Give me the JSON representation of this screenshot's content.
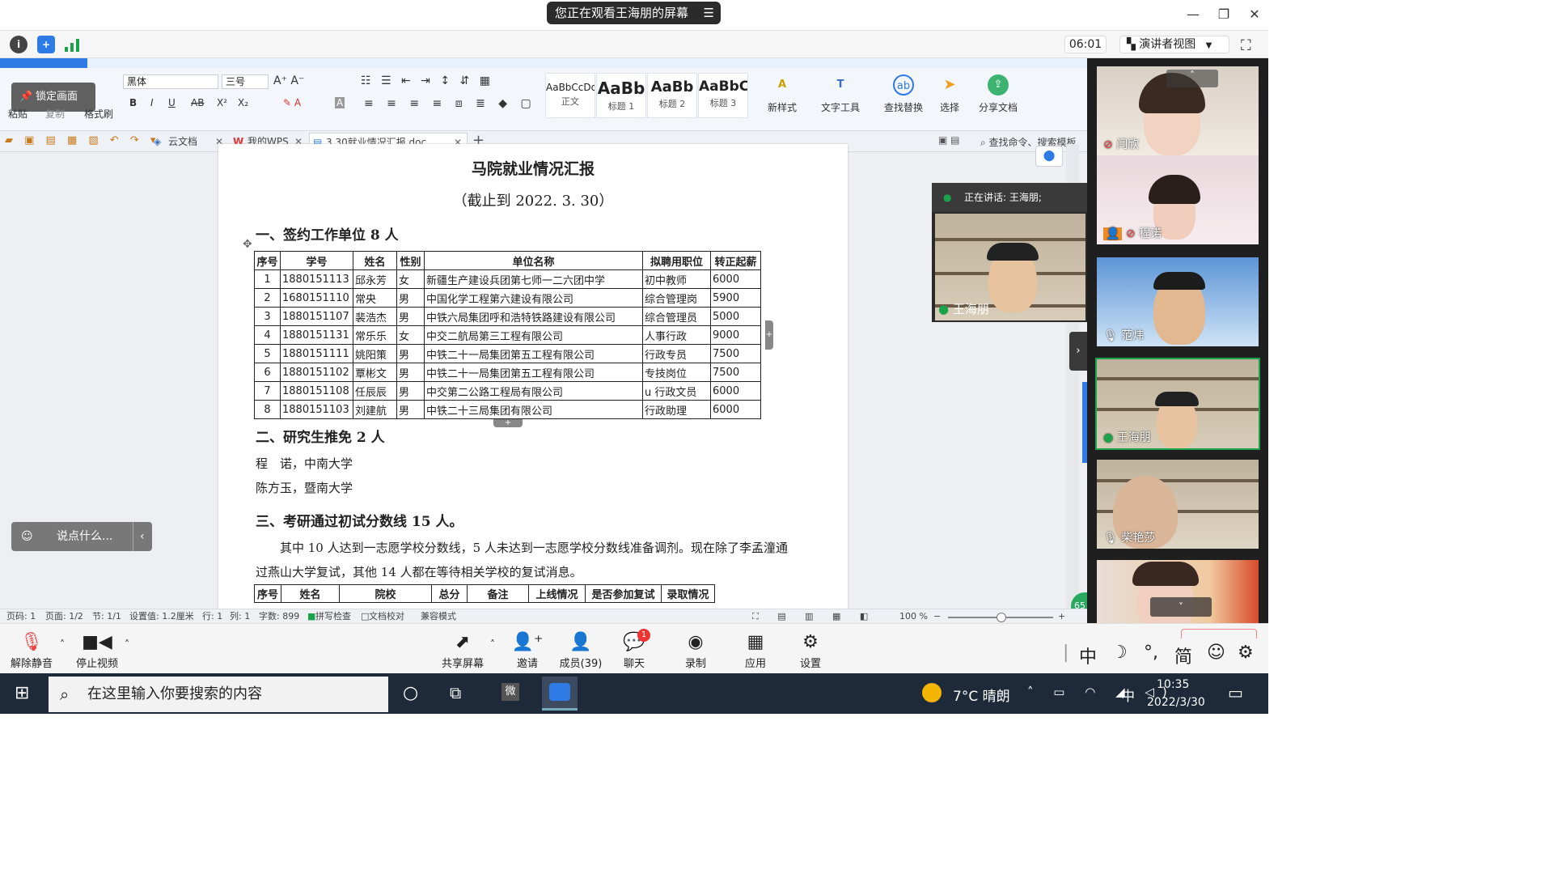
{
  "banner": {
    "text": "您正在观看王海朋的屏幕",
    "menu_icon": "list-icon"
  },
  "window_controls": {
    "minimize": "—",
    "restore": "❐",
    "close": "✕"
  },
  "meeting_top": {
    "timer": "06:01",
    "view_mode": "演讲者视图",
    "view_icon": "chevron-down-icon"
  },
  "wps": {
    "lock_screen": "锁定画面",
    "font_name": "黑体",
    "font_size": "三号",
    "format_row": [
      "B",
      "I",
      "U",
      "AB",
      "X²",
      "X₂"
    ],
    "clipboard": {
      "paste": "粘贴",
      "copy": "复制",
      "format_brush": "格式刷"
    },
    "styles": [
      {
        "sample": "AaBbCcDd",
        "name": "正文"
      },
      {
        "sample": "AaBb",
        "name": "标题 1"
      },
      {
        "sample": "AaBb",
        "name": "标题 2"
      },
      {
        "sample": "AaBbC",
        "name": "标题 3"
      }
    ],
    "tools": [
      "新样式",
      "文字工具",
      "查找替换",
      "选择",
      "分享文档"
    ],
    "tabs": [
      "云文档",
      "我的WPS",
      "3.30就业情况汇报.doc"
    ],
    "search_command": "查找命令、搜索模板"
  },
  "doc": {
    "title": "马院就业情况汇报",
    "subtitle": "（截止到 2022. 3. 30）",
    "section1": "一、签约工作单位 8 人",
    "table1": {
      "headers": [
        "序号",
        "学号",
        "姓名",
        "性别",
        "单位名称",
        "拟聘用职位",
        "转正起薪"
      ],
      "rows": [
        [
          "1",
          "1880151113",
          "邱永芳",
          "女",
          "新疆生产建设兵团第七师一二六团中学",
          "初中教师",
          "6000"
        ],
        [
          "2",
          "1680151110",
          "常央",
          "男",
          "中国化学工程第六建设有限公司",
          "综合管理岗",
          "5900"
        ],
        [
          "3",
          "1880151107",
          "裴浩杰",
          "男",
          "中铁六局集团呼和浩特铁路建设有限公司",
          "综合管理员",
          "5000"
        ],
        [
          "4",
          "1880151131",
          "常乐乐",
          "女",
          "中交二航局第三工程有限公司",
          "人事行政",
          "9000"
        ],
        [
          "5",
          "1880151111",
          "姚阳策",
          "男",
          "中铁二十一局集团第五工程有限公司",
          "行政专员",
          "7500"
        ],
        [
          "6",
          "1880151102",
          "覃彬文",
          "男",
          "中铁二十一局集团第五工程有限公司",
          "专技岗位",
          "7500"
        ],
        [
          "7",
          "1880151108",
          "任辰辰",
          "男",
          "中交第二公路工程局有限公司",
          "u 行政文员",
          "6000"
        ],
        [
          "8",
          "1880151103",
          "刘建航",
          "男",
          "中铁二十三局集团有限公司",
          "行政助理",
          "6000"
        ]
      ]
    },
    "section2": "二、研究生推免 2 人",
    "line_a": "程　诺，中南大学",
    "line_b": "陈方玉，暨南大学",
    "section3": "三、考研通过初试分数线 15 人。",
    "para1": "其中 10 人达到一志愿学校分数线，5 人未达到一志愿学校分数线准备调剂。现在除了李孟潼通",
    "para2": "过燕山大学复试，其他 14 人都在等待相关学校的复试消息。",
    "table2_headers": [
      "序号",
      "姓名",
      "院校",
      "总分",
      "备注",
      "上线情况",
      "是否参加复试",
      "录取情况"
    ]
  },
  "status_bar": {
    "page_count": "页码: 1",
    "page": "页面: 1/2",
    "section": "节: 1/1",
    "setting": "设置值: 1.2厘米",
    "row": "行: 1",
    "col": "列: 1",
    "words": "字数: 899",
    "spell": "拼写检查",
    "proof": "文档校对",
    "mode": "兼容模式",
    "zoom": "100 %"
  },
  "chat": {
    "placeholder": "说点什么..."
  },
  "speaker": {
    "label": "正在讲话: 王海朋;",
    "name": "王海朋"
  },
  "participants": [
    {
      "name": "闫欣"
    },
    {
      "name": "程诺"
    },
    {
      "name": "范炜"
    },
    {
      "name": "王海朋"
    },
    {
      "name": "柴艳莎"
    },
    {
      "name": ""
    }
  ],
  "controls": [
    {
      "label": "解除静音",
      "icon": "mic-off-icon"
    },
    {
      "label": "停止视频",
      "icon": "video-icon"
    },
    {
      "label": "共享屏幕",
      "icon": "share-screen-icon"
    },
    {
      "label": "邀请",
      "icon": "invite-icon"
    },
    {
      "label": "成员(39)",
      "icon": "members-icon"
    },
    {
      "label": "聊天",
      "icon": "chat-icon",
      "badge": "1"
    },
    {
      "label": "录制",
      "icon": "record-icon"
    },
    {
      "label": "应用",
      "icon": "apps-icon"
    },
    {
      "label": "设置",
      "icon": "settings-icon"
    }
  ],
  "ime": {
    "lang": "中",
    "moon": "☽",
    "punct": "°,",
    "simp": "简",
    "emoji": "☺",
    "gear": "⚙"
  },
  "taskbar": {
    "search_placeholder": "在这里输入你要搜索的内容",
    "weather": "7°C  晴朗",
    "ime_lang": "中",
    "time": "10:35",
    "date": "2022/3/30"
  },
  "colors": {
    "accent": "#2f7be5",
    "green": "#1aa34a",
    "taskbar": "#1e2a3a"
  }
}
